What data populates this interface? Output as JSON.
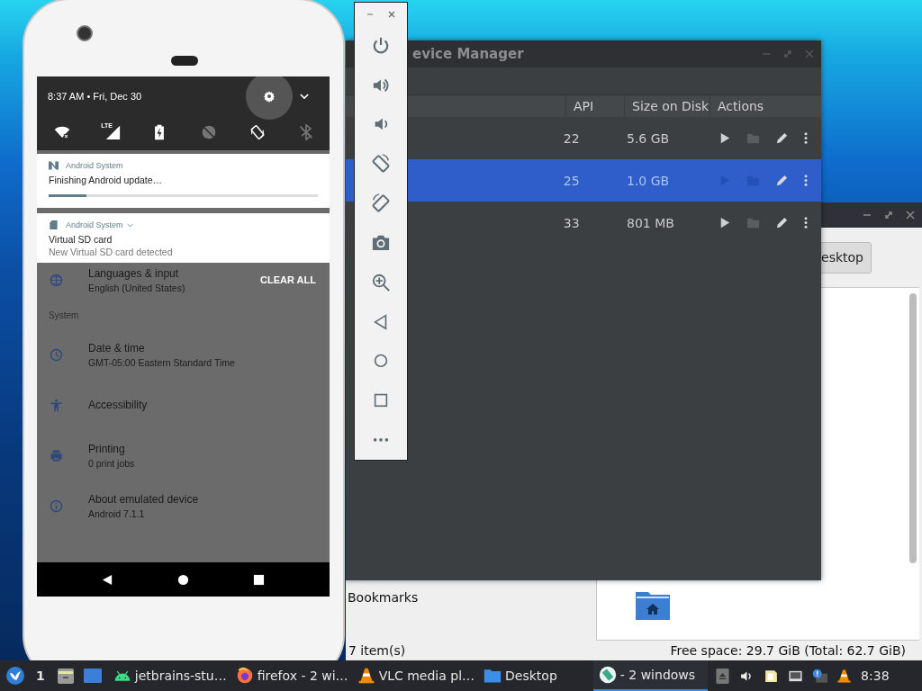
{
  "phone": {
    "status_time": "8:37 AM • Fri, Dec 30",
    "quick_tiles": [
      {
        "kind": "wifi",
        "on": true
      },
      {
        "kind": "cellular",
        "on": true,
        "badge": "LTE"
      },
      {
        "kind": "battery",
        "on": true
      },
      {
        "kind": "datasaver",
        "on": false
      },
      {
        "kind": "rotate",
        "on": true
      },
      {
        "kind": "bluetooth",
        "on": false
      }
    ],
    "notifications": [
      {
        "kind": "progress",
        "app": "Android System",
        "title": "Finishing Android update…",
        "level": 0.14
      },
      {
        "kind": "sdcard",
        "app": "Android System",
        "expandable": true,
        "title": "Virtual SD card",
        "text": "New Virtual SD card detected"
      }
    ],
    "clear_all": "CLEAR ALL",
    "settings_top": [
      {
        "title": "Languages & input",
        "subtitle": "English (United States)"
      }
    ],
    "section_header": "System",
    "settings": [
      {
        "title": "Date & time",
        "subtitle": "GMT-05:00 Eastern Standard Time"
      },
      {
        "title": "Accessibility"
      },
      {
        "title": "Printing",
        "subtitle": "0 print jobs"
      },
      {
        "title": "About emulated device",
        "subtitle": "Android 7.1.1"
      }
    ]
  },
  "device_manager": {
    "title": "evice Manager",
    "columns": [
      "API",
      "Size on Disk",
      "Actions"
    ],
    "rows": [
      {
        "api": "22",
        "size": "5.6 GB",
        "selected": false
      },
      {
        "api": "25",
        "size": "1.0 GB",
        "selected": true
      },
      {
        "api": "33",
        "size": "801 MB",
        "selected": false
      }
    ]
  },
  "file_manager": {
    "path_button": "esktop",
    "bookmarks": "Bookmarks",
    "item_count": "7 item(s)",
    "free_space": "Free space: 29.7 GiB (Total: 62.7 GiB)"
  },
  "taskbar": {
    "workspace": "1",
    "tasks": [
      {
        "kind": "android",
        "label": "jetbrains-stu…",
        "selected": false
      },
      {
        "kind": "firefox",
        "label": "firefox - 2 wi…",
        "selected": false
      },
      {
        "kind": "vlc",
        "label": "VLC media pl…",
        "selected": false
      },
      {
        "kind": "folder",
        "label": "Desktop",
        "selected": false
      },
      {
        "kind": "emulator",
        "label": "- 2 windows",
        "selected": true
      }
    ],
    "clock": "8:38"
  }
}
